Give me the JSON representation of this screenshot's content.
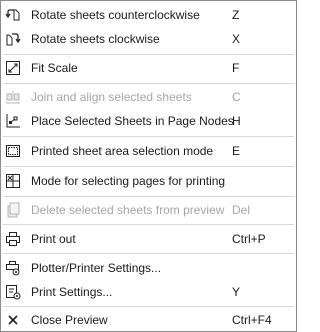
{
  "menu": {
    "items": [
      {
        "label": "Rotate sheets counterclockwise",
        "shortcut": "Z",
        "icon": "rotate-ccw-icon",
        "enabled": true
      },
      {
        "label": "Rotate sheets clockwise",
        "shortcut": "X",
        "icon": "rotate-cw-icon",
        "enabled": true
      },
      {
        "label": "Fit Scale",
        "shortcut": "F",
        "icon": "fit-scale-icon",
        "enabled": true
      },
      {
        "label": "Join and align selected sheets",
        "shortcut": "C",
        "icon": "join-align-icon",
        "enabled": false
      },
      {
        "label": "Place Selected Sheets in Page Nodes",
        "shortcut": "H",
        "icon": "page-nodes-icon",
        "enabled": true
      },
      {
        "label": "Printed sheet area selection mode",
        "shortcut": "E",
        "icon": "area-selection-icon",
        "enabled": true
      },
      {
        "label": "Mode for selecting pages for printing",
        "shortcut": "",
        "icon": "page-select-icon",
        "enabled": true
      },
      {
        "label": "Delete selected sheets from preview",
        "shortcut": "Del",
        "icon": "delete-sheets-icon",
        "enabled": false
      },
      {
        "label": "Print out",
        "shortcut": "Ctrl+P",
        "icon": "printer-icon",
        "enabled": true
      },
      {
        "label": "Plotter/Printer Settings...",
        "shortcut": "",
        "icon": "plotter-settings-icon",
        "enabled": true
      },
      {
        "label": "Print Settings...",
        "shortcut": "Y",
        "icon": "print-settings-icon",
        "enabled": true
      },
      {
        "label": "Close Preview",
        "shortcut": "Ctrl+F4",
        "icon": "close-icon",
        "enabled": true
      }
    ]
  }
}
